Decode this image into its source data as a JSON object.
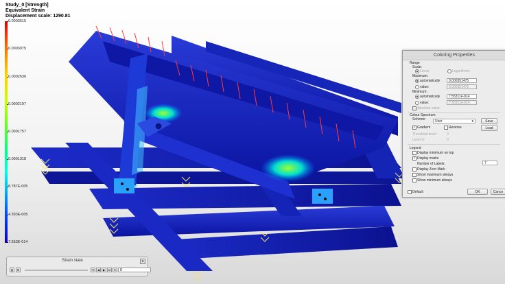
{
  "header": {
    "study": "Study_0 [Strength]",
    "result": "Equivalent Strain",
    "displacement": "Displacement scale: 1290.81"
  },
  "legend_scale": {
    "ticks": [
      "0.0003515",
      "0.0003075",
      "0.0002636",
      "0.0002197",
      "0.0001757",
      "0.0001318",
      "8.787E-005",
      "4.393E-005",
      "7.553E-014"
    ],
    "colors": {
      "max": "#d40000",
      "mid": "#5cff20",
      "min": "#1000c0"
    }
  },
  "coloring": {
    "title": "Coloring Properties",
    "range_label": "Range",
    "scale_label": "Scale:",
    "linear": "Linear",
    "logarithmic": "Logarithmic",
    "maximum_label": "Maximum:",
    "max_auto": "automatically",
    "max_auto_value": "0.000351475",
    "max_value_label": "value:",
    "max_value": "0.000351475",
    "minimum_label": "Minimum:",
    "min_auto": "automatically",
    "min_auto_value": "7.55311e-014",
    "min_value_label": "value:",
    "min_value": "7.55311e-014",
    "absolute_value": "Absolute value",
    "spectrum_label": "Colour Spectrum",
    "scheme_label": "Scheme:",
    "scheme_value": "User",
    "save": "Save",
    "load": "Load",
    "gradient": "Gradient",
    "reverse": "Reverse",
    "threshold_label": "Threshold level:",
    "threshold_value": "0",
    "level_label": "Level U:",
    "level_value": "0",
    "legend_label": "Legend",
    "display_min_top": "Display minimum on top",
    "display_marks": "Display marks",
    "num_labels_label": "Number of Labels:",
    "num_labels": "7",
    "display_zero": "Display Zero Mark",
    "show_max": "Show maximum always",
    "show_min": "Show minimum always",
    "default": "Default",
    "ok": "OK",
    "cancel": "Cance"
  },
  "strain_state": {
    "title": "Strain state",
    "close": "x",
    "value": "0"
  }
}
